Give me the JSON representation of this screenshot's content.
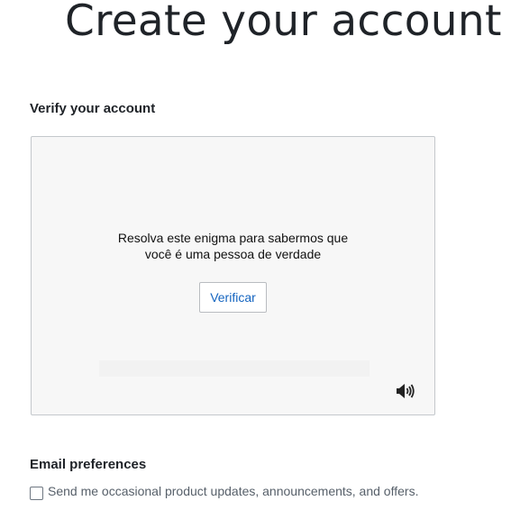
{
  "page": {
    "title": "Create your account"
  },
  "verify": {
    "heading": "Verify your account",
    "prompt_line1": "Resolva este enigma para sabermos que",
    "prompt_line2": "você é uma pessoa de verdade",
    "button_label": "Verificar",
    "audio_icon": "speaker-icon"
  },
  "email_preferences": {
    "heading": "Email preferences",
    "checkbox_label": "Send me occasional product updates, announcements, and offers.",
    "checked": false
  },
  "colors": {
    "link_blue": "#1565c0",
    "frame_border": "#c4c8cc",
    "frame_background": "#f7f7f7"
  }
}
